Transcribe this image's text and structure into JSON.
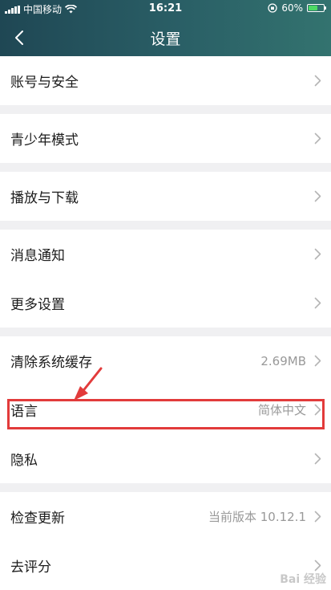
{
  "status_bar": {
    "carrier": "中国移动",
    "time": "16:21",
    "battery": "60%",
    "battery_level": 0.6
  },
  "header": {
    "title": "设置"
  },
  "groups": [
    [
      {
        "label": "账号与安全"
      }
    ],
    [
      {
        "label": "青少年模式"
      }
    ],
    [
      {
        "label": "播放与下载"
      }
    ],
    [
      {
        "label": "消息通知"
      },
      {
        "label": "更多设置"
      }
    ],
    [
      {
        "label": "清除系统缓存",
        "value": "2.69MB"
      },
      {
        "label": "语言",
        "value": "简体中文"
      },
      {
        "label": "隐私"
      }
    ],
    [
      {
        "label": "检查更新",
        "value": "当前版本 10.12.1"
      },
      {
        "label": "去评分"
      }
    ]
  ],
  "annotation": {
    "color": "#e23b3b"
  },
  "watermark": "Bai 经验"
}
